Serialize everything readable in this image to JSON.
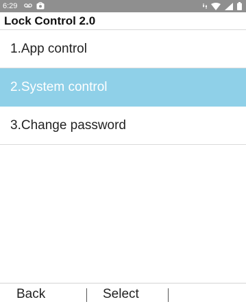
{
  "status_bar": {
    "time": "6:29",
    "icons_left": [
      "voicemail-icon",
      "image-notification-icon"
    ],
    "icons_right": [
      "data-arrows-icon",
      "wifi-icon",
      "signal-icon",
      "battery-icon"
    ]
  },
  "header": {
    "title": "Lock Control 2.0"
  },
  "menu": {
    "items": [
      {
        "label": "1.App control",
        "selected": false
      },
      {
        "label": "2.System control",
        "selected": true
      },
      {
        "label": "3.Change password",
        "selected": false
      }
    ]
  },
  "softkeys": {
    "left": "Back",
    "center": "Select",
    "right": ""
  },
  "colors": {
    "status_bar_bg": "#8f8f8f",
    "selection_bg": "#8fd0e8",
    "text": "#222222"
  }
}
